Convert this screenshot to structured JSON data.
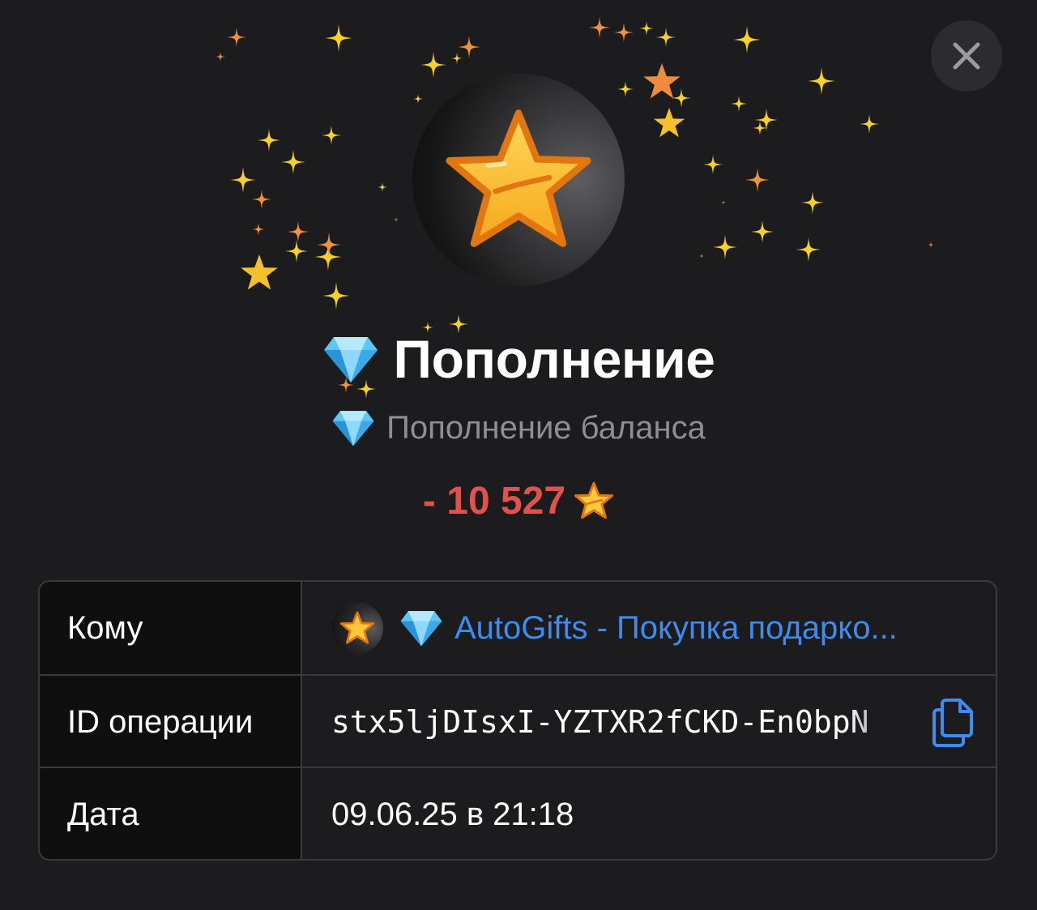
{
  "header": {
    "title": "Пополнение",
    "subtitle": "Пополнение баланса",
    "title_icon": "gem-icon",
    "subtitle_icon": "gem-icon"
  },
  "amount": {
    "text": "- 10 527",
    "icon": "star-icon",
    "color": "#e0524a"
  },
  "details": {
    "rows": [
      {
        "label": "Кому",
        "value": "AutoGifts - Покупка подарко..."
      },
      {
        "label": "ID операции",
        "value": "stx5ljDIsxI-YZTXR2fCKD-En0bpN"
      },
      {
        "label": "Дата",
        "value": "09.06.25 в 21:18"
      }
    ]
  },
  "colors": {
    "background": "#1c1c1e",
    "link": "#3e8cf0",
    "muted": "#8e8e93",
    "star_gold": "#f7c12a",
    "star_orange": "#f08a3c"
  }
}
